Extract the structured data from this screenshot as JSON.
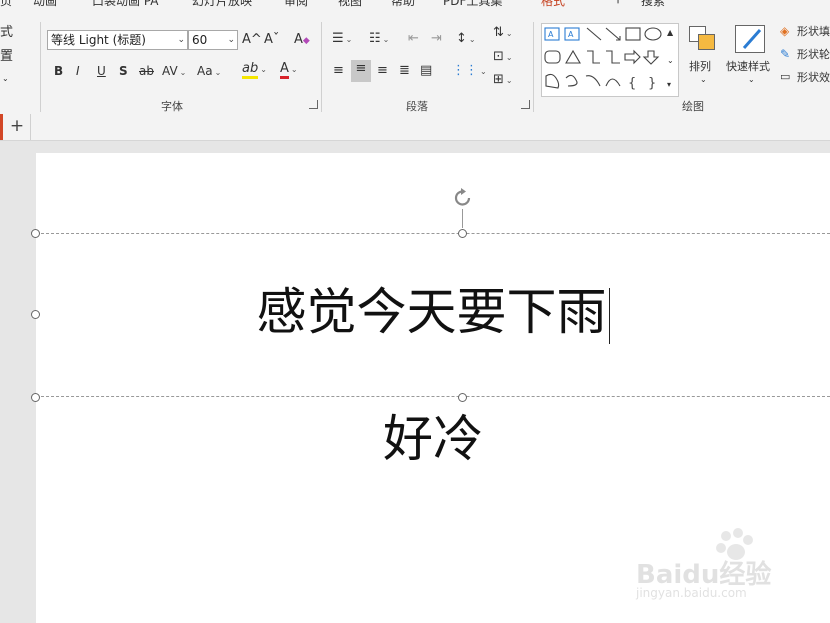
{
  "ribbon_tabs": [
    "动画",
    "口袋动画 PA",
    "幻灯片放映",
    "审阅",
    "视图",
    "帮助",
    "PDF工具集",
    "格式",
    "搜索"
  ],
  "active_tab": "格式",
  "accent_color": "#c43e1c",
  "left_cut_labels": [
    "式",
    "置"
  ],
  "font": {
    "group_label": "字体",
    "font_name": "等线 Light (标题)",
    "font_size": "60",
    "grow_label": "A^",
    "shrink_label": "Aˇ",
    "clear_label": "A",
    "bold": "B",
    "italic": "I",
    "underline": "U",
    "shadow": "S",
    "strike": "ab",
    "spacing": "AV",
    "case": "Aa",
    "highlight": "ab",
    "font_color": "A"
  },
  "paragraph": {
    "group_label": "段落"
  },
  "drawing": {
    "group_label": "绘图",
    "arrange_label": "排列",
    "quick_styles_label": "快速样式",
    "shape_fill_label": "形状填",
    "shape_outline_label": "形状轮",
    "shape_effects_label": "形状效"
  },
  "tab_bar": {
    "add_label": "+"
  },
  "slide": {
    "title_text": "感觉今天要下雨",
    "subtitle_text": "好冷"
  },
  "watermark": {
    "brand": "Baidu经验",
    "url": "jingyan.baidu.com"
  }
}
